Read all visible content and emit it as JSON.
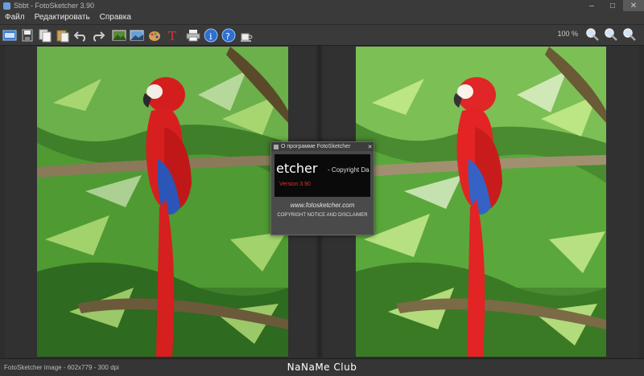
{
  "window": {
    "title": "Sbbt - FotoSketcher 3.90"
  },
  "menu": [
    "Файл",
    "Редактировать",
    "Справка"
  ],
  "toolbar": {
    "buttons": [
      "open-image-icon",
      "save-icon",
      "copy-icon",
      "paste-icon",
      "undo-icon",
      "redo-icon",
      "original-image-icon",
      "result-image-icon",
      "palette-icon",
      "text-icon",
      "print-icon",
      "info-icon",
      "help-icon",
      "coffee-icon"
    ]
  },
  "zoom": {
    "level": "100 %",
    "buttons": [
      "zoom-in-icon",
      "zoom-out-icon",
      "zoom-fit-icon"
    ]
  },
  "dialog": {
    "title": "О программе FotoSketcher",
    "splash_main": "etcher",
    "splash_copy": "- Copyright Da",
    "splash_version": "Version 3.90",
    "url": "www.fotosketcher.com",
    "notice": "COPYRIGHT NOTICE AND DISCLAIMER"
  },
  "status": {
    "text": "FotoSketcher image - 602x779 - 300 dpi"
  },
  "watermark": "NaNaMe Club",
  "colors": {
    "background": "#2b2b2b",
    "menu": "#3a3a3a",
    "accent": "#4a8fd6"
  }
}
